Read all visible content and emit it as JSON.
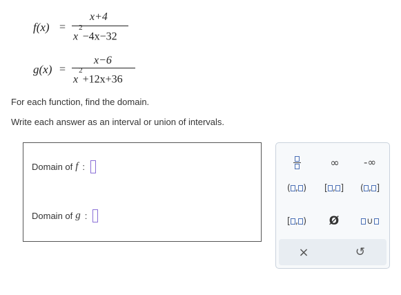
{
  "functions": {
    "f": {
      "label": "f(x)",
      "equals": "=",
      "numerator": "x+4",
      "denominator_base": "x",
      "denominator_exp": "2",
      "denominator_rest": "−4x−32"
    },
    "g": {
      "label": "g(x)",
      "equals": "=",
      "numerator": "x−6",
      "denominator_base": "x",
      "denominator_exp": "2",
      "denominator_rest": "+12x+36"
    }
  },
  "instructions": {
    "line1": "For each function, find the domain.",
    "line2": "Write each answer as an interval or union of intervals."
  },
  "answers": {
    "f_label": "Domain of",
    "f_var": "f",
    "g_label": "Domain of",
    "g_var": "g",
    "colon": ":"
  },
  "palette": {
    "infinity": "∞",
    "neg_infinity": "-∞",
    "empty_set": "Ø",
    "clear": "×",
    "undo": "↺",
    "union_sym": "∪"
  }
}
